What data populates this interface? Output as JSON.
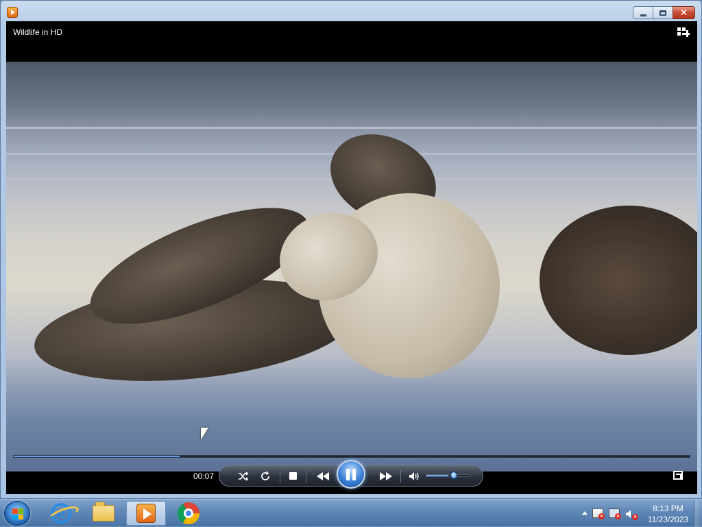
{
  "window": {
    "controls": {
      "minimize": "minimize",
      "maximize": "maximize",
      "close": "close"
    }
  },
  "player": {
    "media_title": "Wildlife in HD",
    "elapsed_time": "00:07",
    "seek_progress": 0.245,
    "volume_level": 0.5,
    "state": "playing"
  },
  "controls": [
    {
      "name": "shuffle",
      "icon": "shuffle-icon"
    },
    {
      "name": "repeat",
      "icon": "repeat-icon"
    },
    {
      "name": "stop",
      "icon": "stop-icon"
    },
    {
      "name": "previous",
      "icon": "rewind-icon"
    },
    {
      "name": "pause",
      "icon": "pause-icon"
    },
    {
      "name": "next",
      "icon": "fast-forward-icon"
    },
    {
      "name": "mute",
      "icon": "speaker-icon"
    }
  ],
  "taskbar": {
    "pinned": [
      "internet-explorer-icon",
      "windows-explorer-icon",
      "windows-media-player-icon",
      "chrome-icon"
    ],
    "active_app": "windows-media-player-icon",
    "clock": {
      "time": "8:13 PM",
      "date": "11/23/2023"
    }
  },
  "colors": {
    "accent": "#3b7ddb",
    "taskbar": "#5f87b6",
    "close_button": "#c74a33"
  }
}
